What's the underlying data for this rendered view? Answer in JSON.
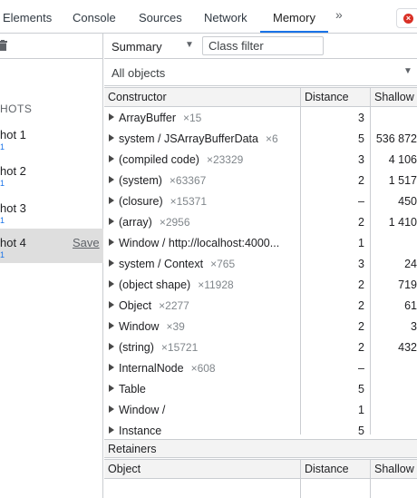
{
  "tabs": [
    {
      "label": "Elements",
      "active": false
    },
    {
      "label": "Console",
      "active": false
    },
    {
      "label": "Sources",
      "active": false
    },
    {
      "label": "Network",
      "active": false
    },
    {
      "label": "Memory",
      "active": true
    }
  ],
  "more_tabs_label": "»",
  "sidebar": {
    "section_title": "HOTS",
    "profiles": [
      {
        "name": "hot 1",
        "size": "1",
        "selected": false
      },
      {
        "name": "hot 2",
        "size": "1",
        "selected": false
      },
      {
        "name": "hot 3",
        "size": "1",
        "selected": false
      },
      {
        "name": "hot 4",
        "size": "1",
        "selected": true,
        "action": "Save"
      }
    ]
  },
  "toolbar": {
    "view": "Summary",
    "class_filter_placeholder": "Class filter",
    "scope": "All objects"
  },
  "table": {
    "columns": [
      "Constructor",
      "Distance",
      "Shallow"
    ],
    "rows": [
      {
        "name": "ArrayBuffer",
        "count": "×15",
        "distance": "3",
        "shallow": ""
      },
      {
        "name": "system / JSArrayBufferData",
        "count": "×6",
        "distance": "5",
        "shallow": "536 872"
      },
      {
        "name": "(compiled code)",
        "count": "×23329",
        "distance": "3",
        "shallow": "4 106"
      },
      {
        "name": "(system)",
        "count": "×63367",
        "distance": "2",
        "shallow": "1 517"
      },
      {
        "name": "(closure)",
        "count": "×15371",
        "distance": "–",
        "shallow": "450"
      },
      {
        "name": "(array)",
        "count": "×2956",
        "distance": "2",
        "shallow": "1 410"
      },
      {
        "name": "Window / http://localhost:4000...",
        "count": "",
        "distance": "1",
        "shallow": ""
      },
      {
        "name": "system / Context",
        "count": "×765",
        "distance": "3",
        "shallow": "24"
      },
      {
        "name": "(object shape)",
        "count": "×11928",
        "distance": "2",
        "shallow": "719"
      },
      {
        "name": "Object",
        "count": "×2277",
        "distance": "2",
        "shallow": "61"
      },
      {
        "name": "Window",
        "count": "×39",
        "distance": "2",
        "shallow": "3"
      },
      {
        "name": "(string)",
        "count": "×15721",
        "distance": "2",
        "shallow": "432"
      },
      {
        "name": "InternalNode",
        "count": "×608",
        "distance": "–",
        "shallow": ""
      },
      {
        "name": "Table",
        "count": "",
        "distance": "5",
        "shallow": ""
      },
      {
        "name": "Window /",
        "count": "",
        "distance": "1",
        "shallow": ""
      },
      {
        "name": "Instance",
        "count": "",
        "distance": "5",
        "shallow": ""
      }
    ]
  },
  "retainers": {
    "title": "Retainers",
    "columns": [
      "Object",
      "Distance",
      "Shallow"
    ]
  }
}
